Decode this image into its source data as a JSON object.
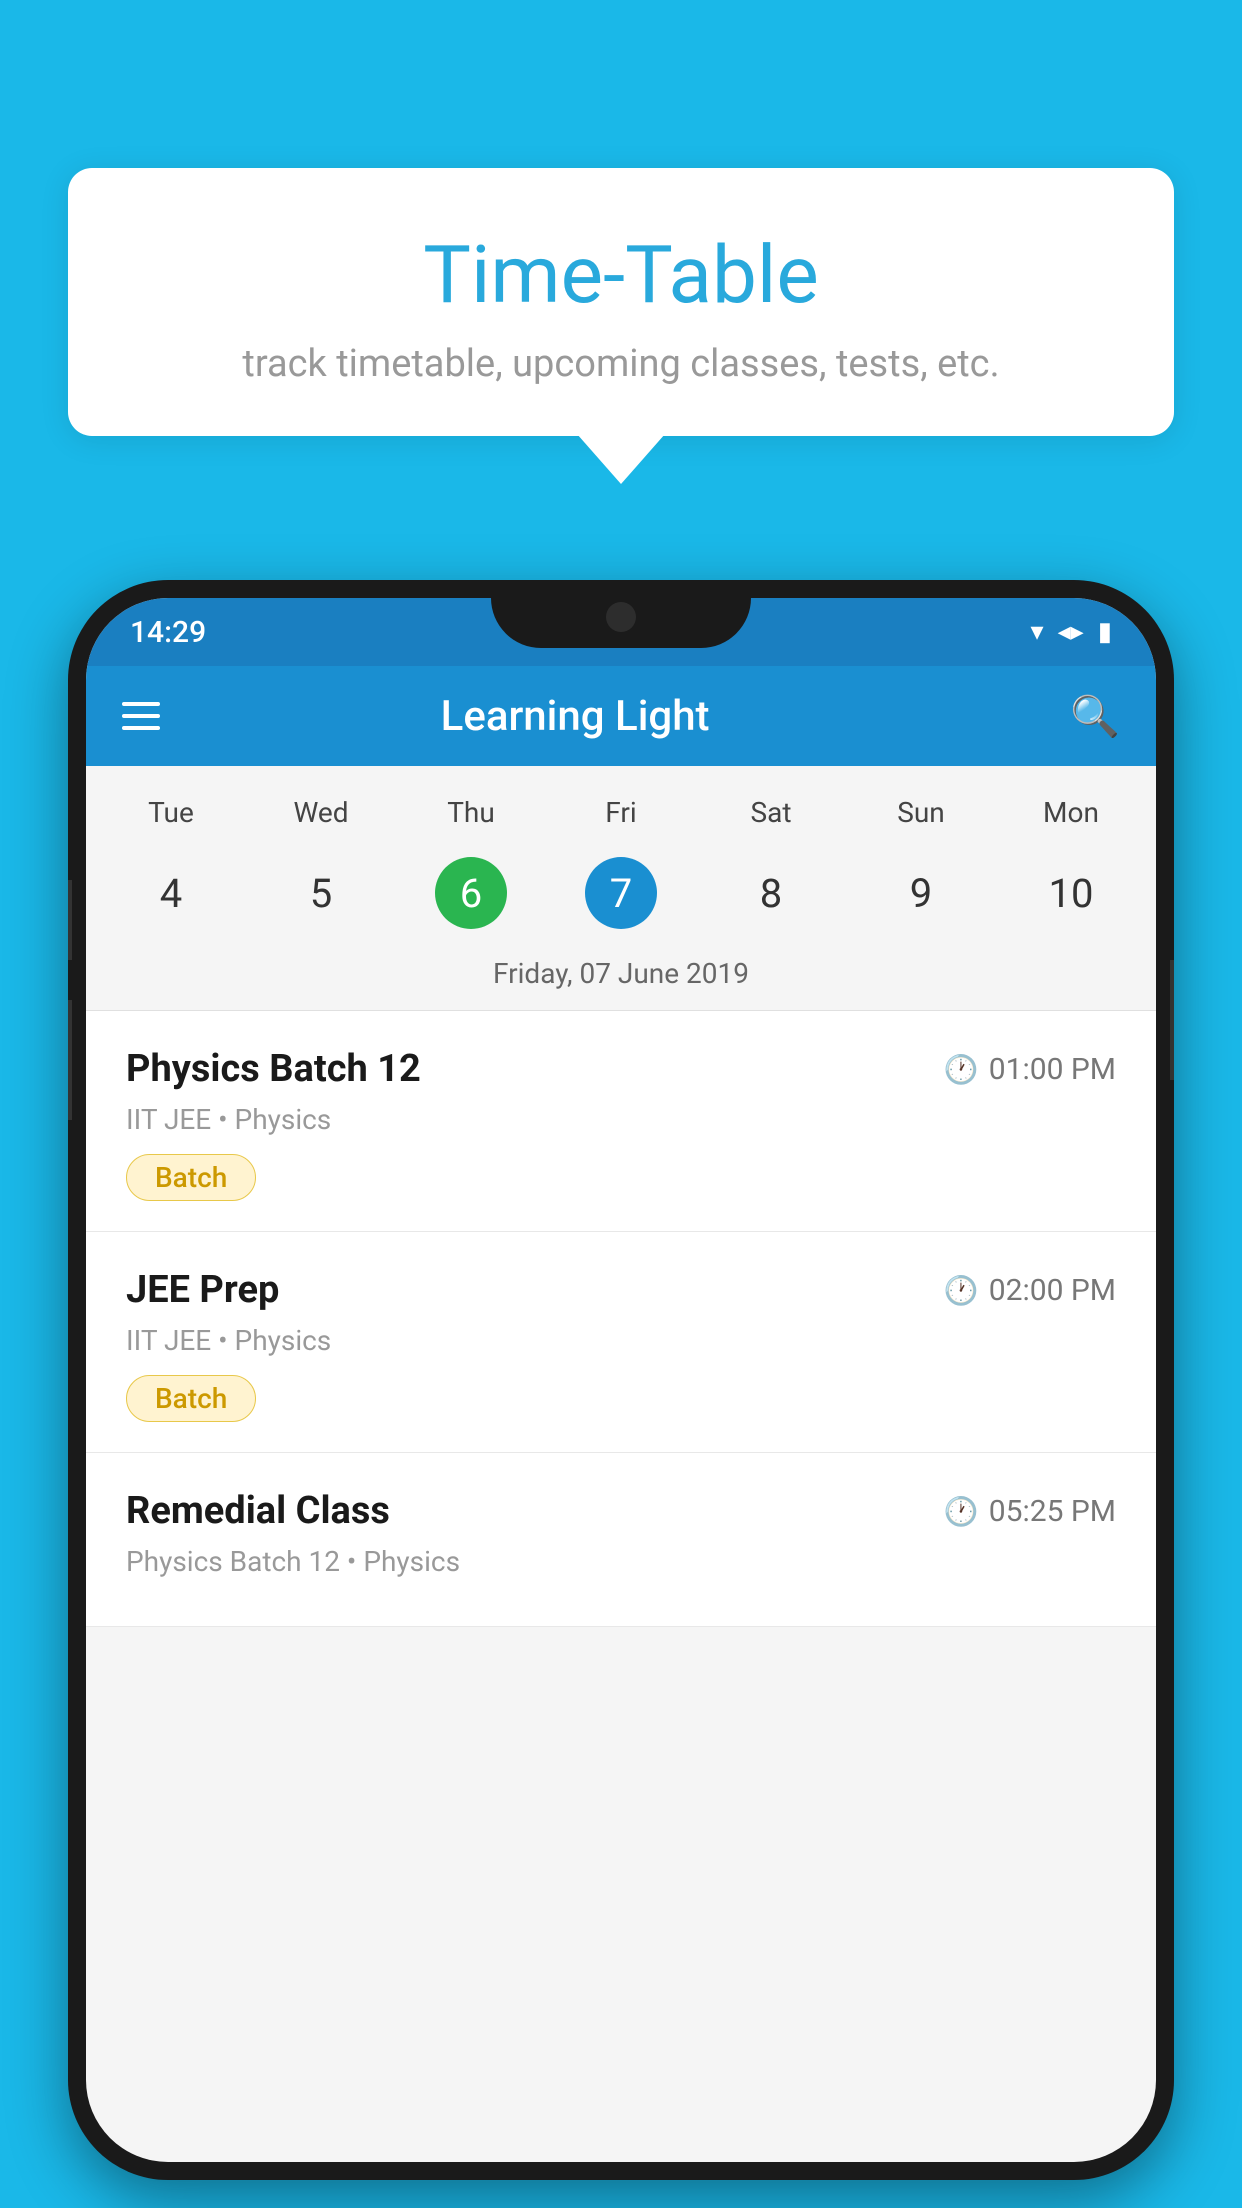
{
  "background": {
    "color": "#1ab8e8"
  },
  "tooltip": {
    "title": "Time-Table",
    "subtitle": "track timetable, upcoming classes, tests, etc."
  },
  "phone": {
    "status_bar": {
      "time": "14:29"
    },
    "app_bar": {
      "title": "Learning Light"
    },
    "calendar": {
      "days_of_week": [
        "Tue",
        "Wed",
        "Thu",
        "Fri",
        "Sat",
        "Sun",
        "Mon"
      ],
      "day_numbers": [
        "4",
        "5",
        "6",
        "7",
        "8",
        "9",
        "10"
      ],
      "today_index": 2,
      "selected_index": 3,
      "selected_date_label": "Friday, 07 June 2019"
    },
    "schedule": [
      {
        "name": "Physics Batch 12",
        "time": "01:00 PM",
        "sub": "IIT JEE • Physics",
        "tag": "Batch"
      },
      {
        "name": "JEE Prep",
        "time": "02:00 PM",
        "sub": "IIT JEE • Physics",
        "tag": "Batch"
      },
      {
        "name": "Remedial Class",
        "time": "05:25 PM",
        "sub": "Physics Batch 12 • Physics",
        "tag": ""
      }
    ]
  }
}
